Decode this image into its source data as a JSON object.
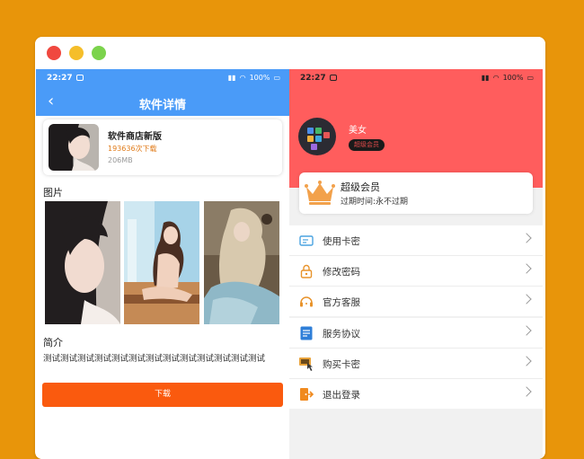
{
  "left_phone": {
    "status_time": "22:27",
    "status_battery": "100%",
    "nav_title": "软件详情",
    "app": {
      "name": "软件商店新版",
      "downloads": "193636次下载",
      "size": "206MB"
    },
    "pictures_heading": "图片",
    "intro_heading": "简介",
    "intro_text": "测试测试测试测试测试测试测试测试测试测试测试测试测试",
    "download_button": "下载",
    "colors": {
      "header": "#4A9BF8",
      "download": "#FA5A0E",
      "downloads_text": "#E07A18"
    }
  },
  "right_phone": {
    "status_time": "22:27",
    "status_battery": "100%",
    "username": "美女",
    "member_badge": "超级会员",
    "vip": {
      "title": "超级会员",
      "expiry": "过期时间:永不过期"
    },
    "menu_group_1": [
      {
        "label": "使用卡密",
        "icon": "card-icon"
      },
      {
        "label": "修改密码",
        "icon": "lock-icon"
      },
      {
        "label": "官方客服",
        "icon": "headset-icon"
      }
    ],
    "menu_group_2": [
      {
        "label": "服务协议",
        "icon": "document-icon"
      },
      {
        "label": "购买卡密",
        "icon": "buy-icon"
      },
      {
        "label": "退出登录",
        "icon": "logout-icon"
      }
    ],
    "colors": {
      "header": "#FF5D5D",
      "crown": "#F2A14B"
    }
  }
}
